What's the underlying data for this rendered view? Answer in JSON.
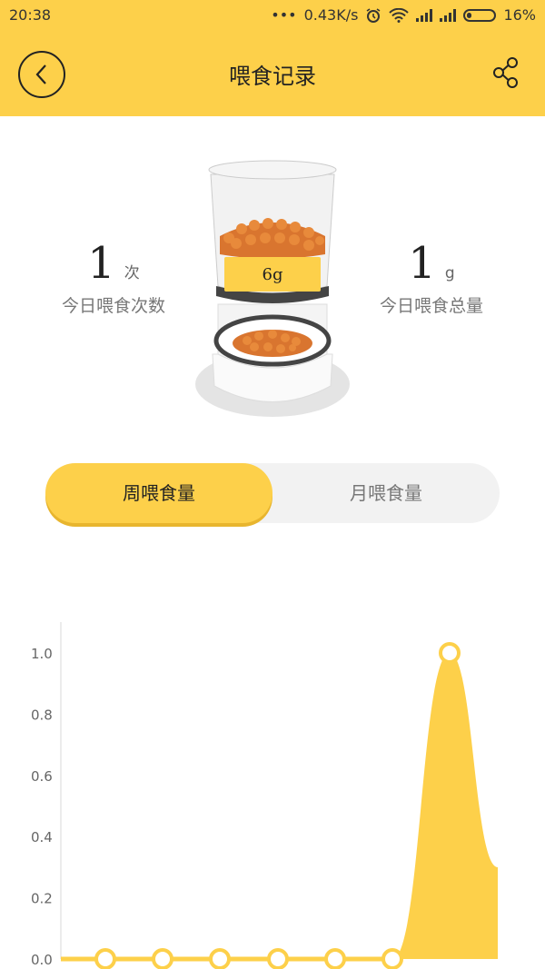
{
  "status_bar": {
    "time": "20:38",
    "network_speed": "0.43K/s",
    "battery": "16%"
  },
  "header": {
    "title": "喂食记录",
    "back_icon": "back-icon",
    "share_icon": "share-icon",
    "background_color": "#fdd04a"
  },
  "feeder": {
    "portion_label": "6g"
  },
  "stats": {
    "count": {
      "value": "1",
      "unit": "次",
      "label": "今日喂食次数"
    },
    "total": {
      "value": "1",
      "unit": "g",
      "label": "今日喂食总量"
    }
  },
  "tabs": [
    {
      "label": "周喂食量",
      "active": true
    },
    {
      "label": "月喂食量",
      "active": false
    }
  ],
  "chart_data": {
    "type": "area",
    "color": "#fdd04a",
    "y_ticks": [
      "0.0",
      "0.2",
      "0.4",
      "0.6",
      "0.8",
      "1.0"
    ],
    "ylim": [
      0,
      1.0
    ],
    "values": [
      0,
      0,
      0,
      0,
      0,
      0,
      1,
      0.3
    ]
  }
}
